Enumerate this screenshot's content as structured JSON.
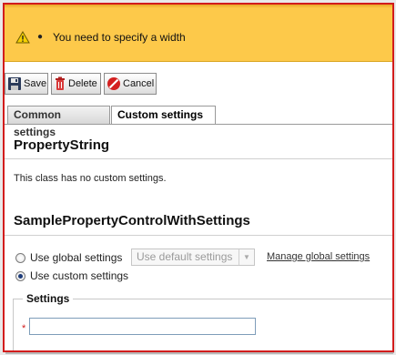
{
  "colors": {
    "frame_border": "#d21c1c",
    "warning_bg": "#fdc94a",
    "required_marker": "#d21c1c"
  },
  "warning": {
    "icon": "warning-triangle-icon",
    "bullet": "●",
    "message": "You need to specify a width"
  },
  "toolbar": {
    "save_label": "Save",
    "delete_label": "Delete",
    "cancel_label": "Cancel"
  },
  "tabs": [
    {
      "label": "Common settings",
      "active": false
    },
    {
      "label": "Custom settings",
      "active": true
    }
  ],
  "property_string": {
    "heading": "PropertyString",
    "description": "This class has no custom settings."
  },
  "sample_control": {
    "heading": "SamplePropertyControlWithSettings",
    "option_global_label": "Use global settings",
    "option_custom_label": "Use custom settings",
    "selected_option": "custom",
    "global_select_value": "Use default settings",
    "manage_link": "Manage global settings"
  },
  "settings_group": {
    "legend": "Settings",
    "required_marker": "*",
    "field_value": ""
  }
}
